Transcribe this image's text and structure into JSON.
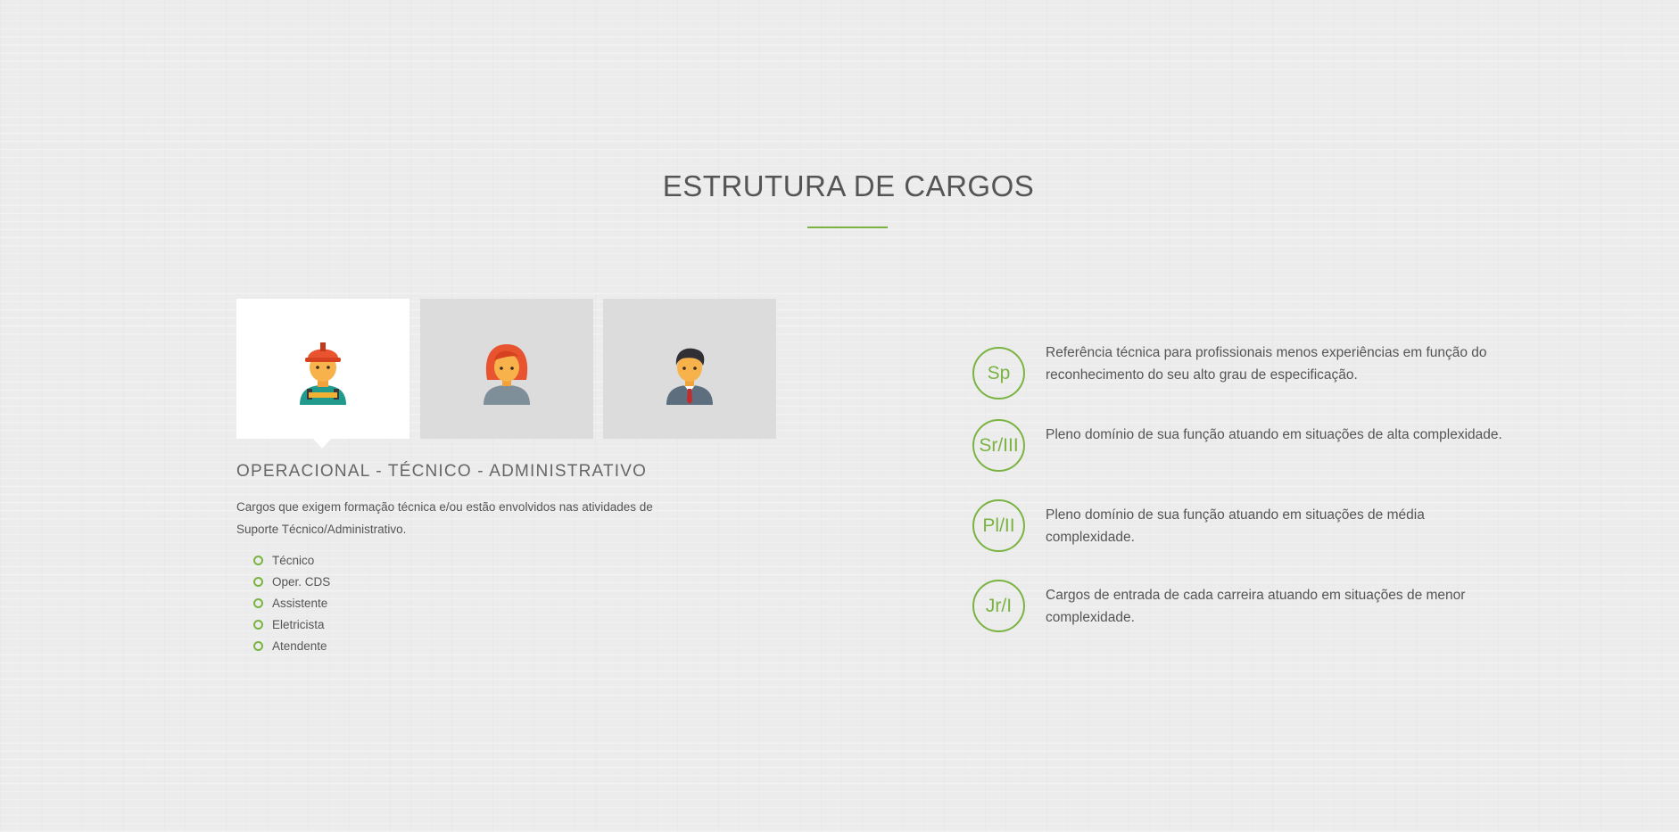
{
  "section": {
    "title": "ESTRUTURA DE CARGOS",
    "accent_color": "#7ab342"
  },
  "tabs": [
    {
      "icon": "worker-helmet-icon",
      "active": true
    },
    {
      "icon": "woman-avatar-icon",
      "active": false
    },
    {
      "icon": "businessman-avatar-icon",
      "active": false
    }
  ],
  "panel": {
    "heading": "OPERACIONAL - TÉCNICO - ADMINISTRATIVO",
    "description": "Cargos que exigem formação técnica e/ou estão envolvidos nas atividades de Suporte Técnico/Administrativo.",
    "items": [
      "Técnico",
      "Oper. CDS",
      "Assistente",
      "Eletricista",
      "Atendente"
    ]
  },
  "levels": [
    {
      "badge": "Sp",
      "text": "Referência técnica para profissionais menos experiências em função do reconhecimento do seu alto grau de especificação."
    },
    {
      "badge": "Sr/III",
      "text": "Pleno domínio de sua função atuando em situações de alta complexidade."
    },
    {
      "badge": "Pl/II",
      "text": "Pleno domínio de sua função atuando em situações de média complexidade."
    },
    {
      "badge": "Jr/I",
      "text": "Cargos de entrada de cada carreira atuando em situações de menor complexidade."
    }
  ]
}
